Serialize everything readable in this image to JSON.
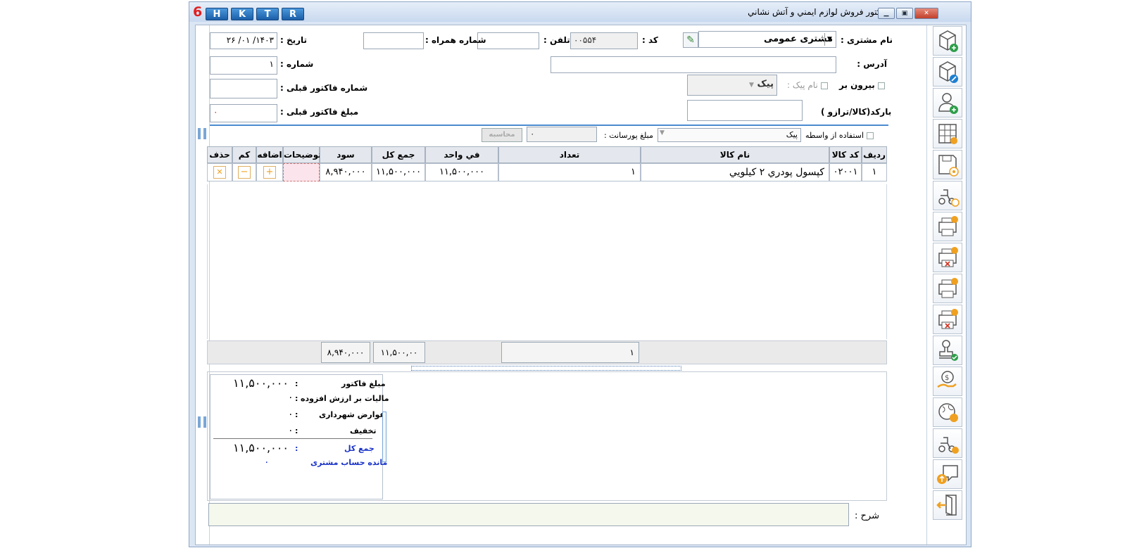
{
  "window": {
    "title": "فاكتور فروش لوازم ايمني و آتش نشاني",
    "shortcut_buttons": [
      "H",
      "K",
      "T",
      "R"
    ],
    "logo_text": "6"
  },
  "form": {
    "customer_label": "نام مشتری :",
    "customer_value": "مشتری عمومی",
    "code_label": "کد :",
    "code_value": "۰۰۵۵۴",
    "phone_label": "تلفن :",
    "phone_value": "",
    "mobile_label": "شماره همراه :",
    "mobile_value": "",
    "date_label": "تاریخ :",
    "date_value": "۱۴۰۳/ ۰۱/ ۲۶",
    "address_label": "آدرس :",
    "address_value": "",
    "number_label": "شماره :",
    "number_value": "۱",
    "outbound_label": "بیرون بر",
    "courier_name_label": "نام پیک :",
    "courier_value": "پیک",
    "prev_invoice_number_label": "شماره فاکتور قبلی :",
    "prev_invoice_number_value": "",
    "barcode_label": "بارکد(کالا/ترازو )",
    "barcode_value": "",
    "prev_invoice_amount_label": "مبلغ فاکتور قبلی :",
    "prev_invoice_amount_value": "۰",
    "use_intermediary_label": "استفاده از واسطه",
    "intermediary_value": "پیک",
    "commission_label": "مبلغ پورسانت :",
    "commission_value": "۰",
    "calculate_label": "محاسبه"
  },
  "grid": {
    "headers": {
      "row": "ردیف",
      "code": "کد کالا",
      "name": "نام کالا",
      "qty": "تعداد",
      "unit_price": "في واحد",
      "total": "جمع کل",
      "profit": "سود",
      "desc": "توضیحات",
      "add": "اضافه",
      "less": "کم",
      "del": "حذف"
    },
    "rows": [
      {
        "row": "۱",
        "code": "۰۲۰۰۱",
        "name": "کپسول پودري ۲ کيلويي",
        "qty": "۱",
        "unit_price": "۱۱,۵۰۰,۰۰۰",
        "total": "۱۱,۵۰۰,۰۰۰",
        "profit": "۸,۹۴۰,۰۰۰",
        "desc": ""
      }
    ],
    "totals": {
      "qty": "۱",
      "total": "۱۱,۵۰۰,۰۰",
      "profit": "۸,۹۴۰,۰۰۰"
    }
  },
  "summary": {
    "invoice_amount_label": "مبلغ فاکتور",
    "invoice_amount_value": "۱۱,۵۰۰,۰۰۰",
    "vat_label": "مالیات بر ارزش افزوده",
    "vat_value": "۰",
    "municipal_label": "عوارض شهرداری",
    "municipal_value": "۰",
    "discount_label": "تخفیف",
    "discount_value": "۰",
    "grand_total_label": "جمع کل",
    "grand_total_value": "۱۱,۵۰۰,۰۰۰",
    "balance_label": "مانده حساب مشتری",
    "balance_value": "۰",
    "colon": ":"
  },
  "description": {
    "label": "شرح :",
    "value": ""
  },
  "colors": {
    "accent_blue": "#1f5fb0",
    "link_blue": "#1a33c8",
    "button_orange": "#f0a020",
    "button_green": "#2e9e4a"
  },
  "sidebar_icons": [
    "new-invoice-icon",
    "edit-invoice-icon",
    "add-customer-icon",
    "price-table-icon",
    "save-preview-icon",
    "courier-view-icon",
    "print-invoice-icon",
    "print-cancel-icon",
    "print-info-icon",
    "print-info-cancel-icon",
    "stamp-approve-icon",
    "payment-hand-icon",
    "currency-globe-icon",
    "courier-payment-icon",
    "message-upload-icon",
    "exit-icon"
  ]
}
